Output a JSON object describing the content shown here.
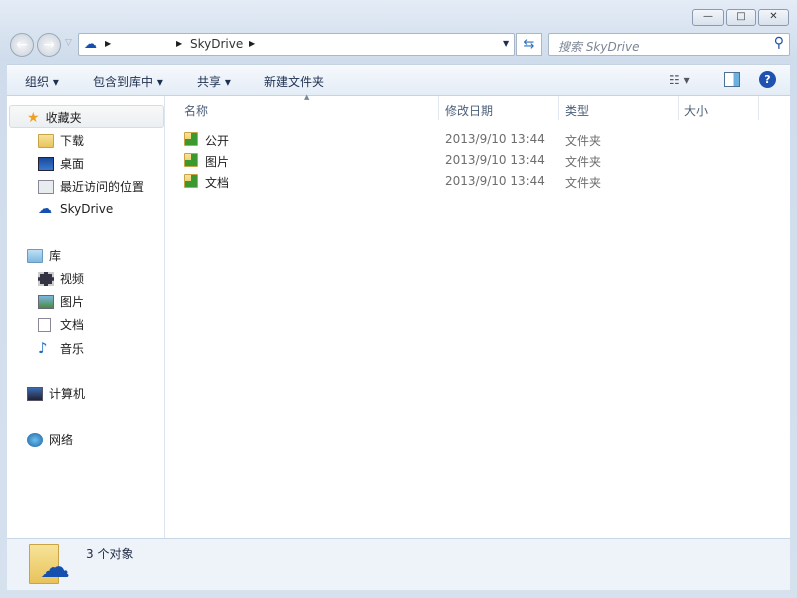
{
  "window": {
    "minimize": "—",
    "maximize": "□",
    "close": "✕"
  },
  "address": {
    "path": [
      "",
      "SkyDrive"
    ],
    "refresh_icon": "refresh-icon"
  },
  "search": {
    "placeholder": "搜索 SkyDrive"
  },
  "toolbar": {
    "organize": "组织",
    "include_in_library": "包含到库中",
    "share": "共享",
    "new_folder": "新建文件夹"
  },
  "sidebar": {
    "favorites": {
      "label": "收藏夹",
      "items": [
        {
          "label": "下载"
        },
        {
          "label": "桌面"
        },
        {
          "label": "最近访问的位置"
        },
        {
          "label": "SkyDrive"
        }
      ]
    },
    "libraries": {
      "label": "库",
      "items": [
        {
          "label": "视频"
        },
        {
          "label": "图片"
        },
        {
          "label": "文档"
        },
        {
          "label": "音乐"
        }
      ]
    },
    "computer": {
      "label": "计算机"
    },
    "network": {
      "label": "网络"
    }
  },
  "columns": {
    "name": "名称",
    "date": "修改日期",
    "type": "类型",
    "size": "大小"
  },
  "files": [
    {
      "name": "公开",
      "date": "2013/9/10 13:44",
      "type": "文件夹"
    },
    {
      "name": "图片",
      "date": "2013/9/10 13:44",
      "type": "文件夹"
    },
    {
      "name": "文档",
      "date": "2013/9/10 13:44",
      "type": "文件夹"
    }
  ],
  "status": {
    "count": "3 个对象"
  }
}
